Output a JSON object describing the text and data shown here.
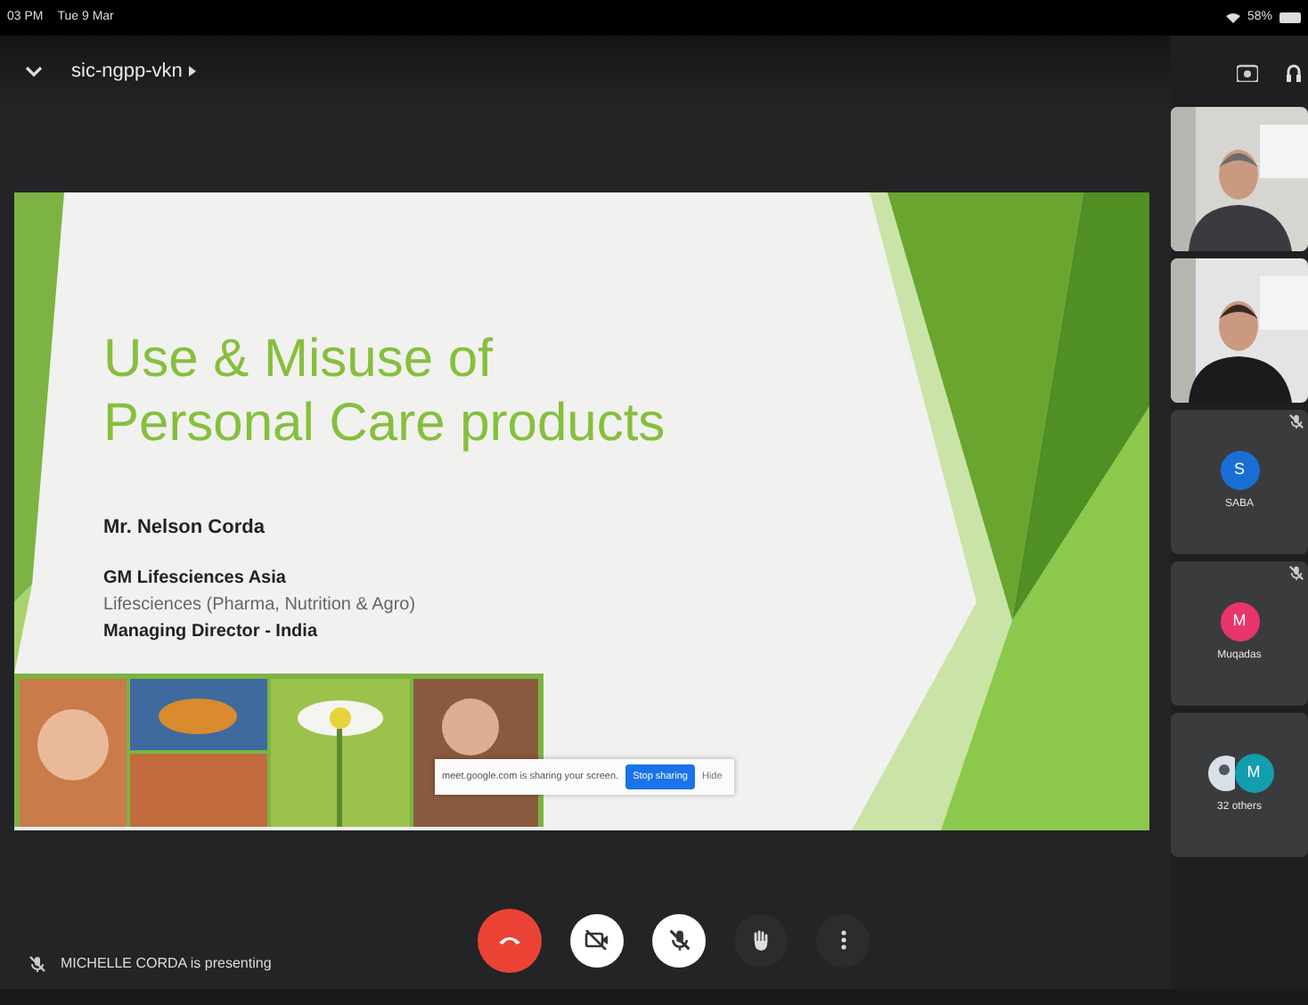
{
  "status_bar": {
    "time": "03 PM",
    "date": "Tue 9 Mar",
    "battery": "58%"
  },
  "meeting": {
    "title": "sic-ngpp-vkn"
  },
  "slide": {
    "title_lines": [
      "Use & Misuse of",
      "Personal Care products"
    ],
    "lines": [
      {
        "text": "Mr. Nelson Corda",
        "kind": "name"
      },
      {
        "text": "GM Lifesciences Asia",
        "kind": "bold"
      },
      {
        "text": "Lifesciences (Pharma, Nutrition & Agro)",
        "kind": "light"
      },
      {
        "text": "Managing Director - India",
        "kind": "bold"
      }
    ]
  },
  "share_bar": {
    "message": "meet.google.com is sharing your screen.",
    "stop": "Stop sharing",
    "hide": "Hide"
  },
  "participants": [
    {
      "kind": "video"
    },
    {
      "kind": "video"
    },
    {
      "kind": "avatar",
      "initial": "S",
      "name": "SABA",
      "color": "#1a6fd6",
      "muted": true
    },
    {
      "kind": "avatar",
      "initial": "M",
      "name": "Muqadas",
      "color": "#e8356b",
      "muted": true
    },
    {
      "kind": "others",
      "initial": "M",
      "name": "32 others",
      "color": "#129eaf"
    }
  ],
  "presenting": {
    "text": "MICHELLE CORDA is presenting",
    "muted": true
  },
  "controls": [
    {
      "kind": "hangup"
    },
    {
      "kind": "camera",
      "off": true
    },
    {
      "kind": "mic",
      "off": true
    },
    {
      "kind": "hand"
    },
    {
      "kind": "more"
    }
  ]
}
